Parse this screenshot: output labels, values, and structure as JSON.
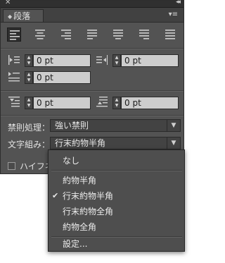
{
  "panel": {
    "close_glyph": "✕",
    "collapse_glyph": "◂◂",
    "tab_title": "段落",
    "tab_updown_glyph": "◆",
    "menu_glyph": "▾≡"
  },
  "alignment_buttons": [
    {
      "name": "align-left",
      "selected": true
    },
    {
      "name": "align-center",
      "selected": false
    },
    {
      "name": "align-right",
      "selected": false
    },
    {
      "name": "justify-last-left",
      "selected": false
    },
    {
      "name": "justify-last-center",
      "selected": false
    },
    {
      "name": "justify-last-right",
      "selected": false
    },
    {
      "name": "justify-all",
      "selected": false
    }
  ],
  "indents": {
    "left_indent": "0 pt",
    "right_indent": "0 pt",
    "first_line_indent": "0 pt",
    "space_before": "0 pt",
    "space_after": "0 pt"
  },
  "kinsoku": {
    "label": "禁則処理：",
    "value": "強い禁則"
  },
  "mojikumi": {
    "label": "文字組み：",
    "value": "行末約物半角"
  },
  "hyphenation": {
    "label": "ハイフネ"
  },
  "popup": {
    "items": [
      {
        "label": "なし",
        "checked": false
      },
      {
        "label": "約物半角",
        "checked": false
      },
      {
        "label": "行末約物半角",
        "checked": true
      },
      {
        "label": "行末約物全角",
        "checked": false
      },
      {
        "label": "約物全角",
        "checked": false
      },
      {
        "label": "設定...",
        "checked": false
      }
    ],
    "check_glyph": "✔"
  },
  "colors": {
    "panel_bg": "#535353",
    "field_bg": "#cdcdcd",
    "popup_bg": "#4e4e4e"
  }
}
